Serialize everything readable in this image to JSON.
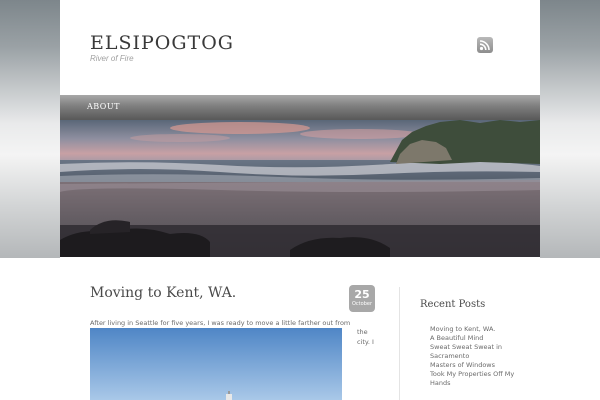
{
  "site": {
    "title": "ELSIPOGTOG",
    "description": "River of Fire"
  },
  "header": {
    "rss_icon": "rss-feed-icon"
  },
  "nav": {
    "items": [
      {
        "label": "ABOUT"
      }
    ]
  },
  "post": {
    "title": "Moving to Kent, WA.",
    "date": {
      "day": "25",
      "month": "October"
    },
    "excerpt": "After living in Seattle for five years, I was ready to move a little farther out from",
    "excerpt_continued": "the city. I"
  },
  "sidebar": {
    "title": "Recent Posts",
    "items": [
      {
        "label": "Moving to Kent, WA."
      },
      {
        "label": "A Beautiful Mind"
      },
      {
        "label": "Sweat Sweat Sweat in Sacramento"
      },
      {
        "label": "Masters of Windows"
      },
      {
        "label": "Took My Properties Off My Hands"
      }
    ]
  },
  "colors": {
    "nav": "#7e7e7e",
    "date_badge": "#a8a8a8",
    "text": "#4a4a4a",
    "muted": "#a0a0a0"
  }
}
